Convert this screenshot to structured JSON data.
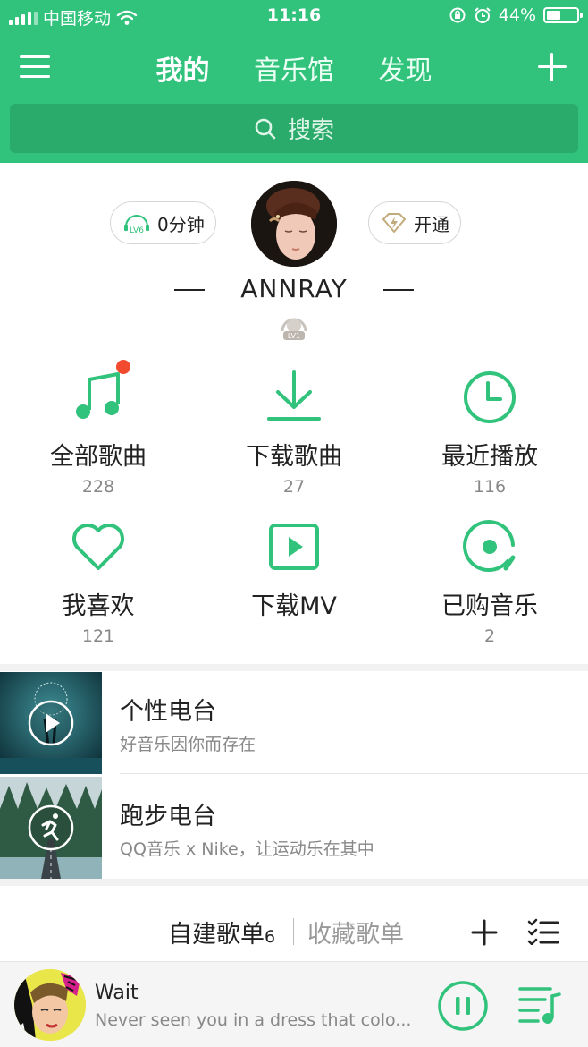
{
  "status_bar": {
    "carrier": "中国移动",
    "time": "11:16",
    "battery_percent": "44%"
  },
  "nav": {
    "tabs": [
      "我的",
      "音乐馆",
      "发现"
    ],
    "active_tab": "我的"
  },
  "search": {
    "placeholder": "搜索"
  },
  "profile": {
    "listen_pill": {
      "level": "LV6",
      "text": "0分钟"
    },
    "vip_pill": {
      "text": "开通"
    },
    "username": "ANNRAY",
    "level_badge": "LV1"
  },
  "grid": [
    {
      "label": "全部歌曲",
      "count": "228",
      "icon": "music-note-icon",
      "has_dot": true
    },
    {
      "label": "下载歌曲",
      "count": "27",
      "icon": "download-icon"
    },
    {
      "label": "最近播放",
      "count": "116",
      "icon": "clock-icon"
    },
    {
      "label": "我喜欢",
      "count": "121",
      "icon": "heart-icon"
    },
    {
      "label": "下载MV",
      "count": "",
      "icon": "play-square-icon"
    },
    {
      "label": "已购音乐",
      "count": "2",
      "icon": "disc-icon"
    }
  ],
  "radios": [
    {
      "title": "个性电台",
      "subtitle": "好音乐因你而存在",
      "icon": "play-icon"
    },
    {
      "title": "跑步电台",
      "subtitle": "QQ音乐 x Nike，让运动乐在其中",
      "icon": "runner-icon"
    }
  ],
  "playlists": {
    "created_label": "自建歌单",
    "created_count": "6",
    "collected_label": "收藏歌单"
  },
  "player": {
    "song": "Wait",
    "lyric": "Never seen you in a dress that colo..."
  },
  "colors": {
    "brand": "#31c27c",
    "search_bg": "#2aab6b",
    "badge_red": "#f24a2f"
  }
}
